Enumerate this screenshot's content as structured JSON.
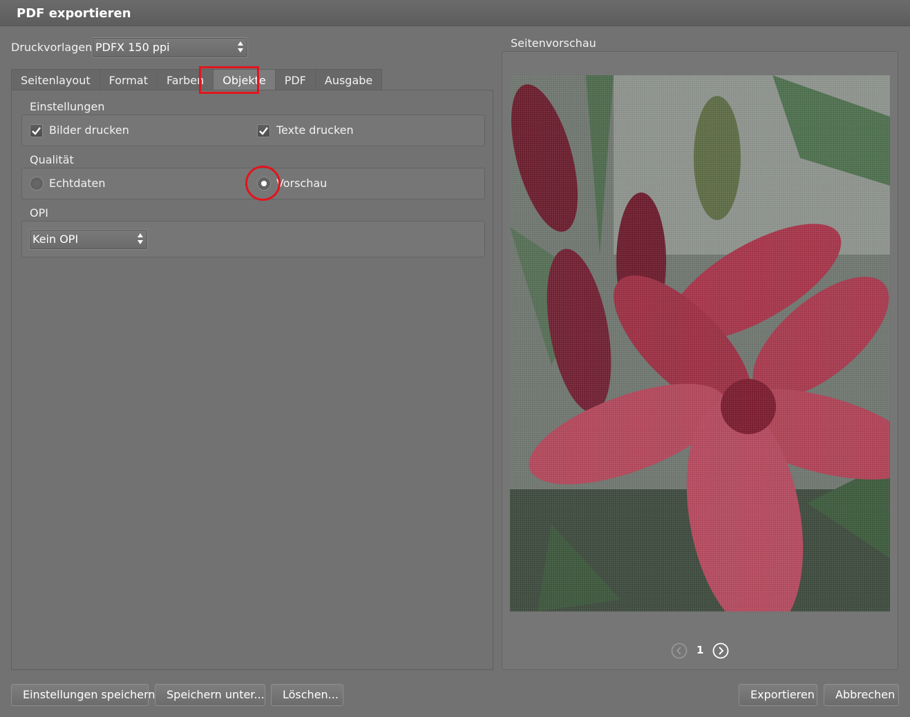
{
  "window": {
    "title": "PDF exportieren"
  },
  "presets": {
    "label": "Druckvorlagen:",
    "value": "PDFX 150 ppi"
  },
  "tabs": [
    {
      "label": "Seitenlayout",
      "active": false
    },
    {
      "label": "Format",
      "active": false
    },
    {
      "label": "Farben",
      "active": false
    },
    {
      "label": "Objekte",
      "active": true
    },
    {
      "label": "PDF",
      "active": false
    },
    {
      "label": "Ausgabe",
      "active": false
    }
  ],
  "settings": {
    "heading": "Einstellungen",
    "print_images": {
      "label": "Bilder drucken",
      "checked": true
    },
    "print_texts": {
      "label": "Texte drucken",
      "checked": true
    }
  },
  "quality": {
    "heading": "Qualität",
    "real_data": {
      "label": "Echtdaten",
      "selected": false
    },
    "preview": {
      "label": "Vorschau",
      "selected": true
    }
  },
  "opi": {
    "heading": "OPI",
    "value": "Kein OPI"
  },
  "preview": {
    "heading": "Seitenvorschau",
    "page": "1",
    "image_subject": "red-lily-photo"
  },
  "buttons": {
    "save_settings": "Einstellungen speichern",
    "save_as": "Speichern unter...",
    "delete": "Löschen...",
    "export": "Exportieren",
    "cancel": "Abbrechen"
  },
  "colors": {
    "highlight": "#e2141c",
    "background": "#727272"
  }
}
